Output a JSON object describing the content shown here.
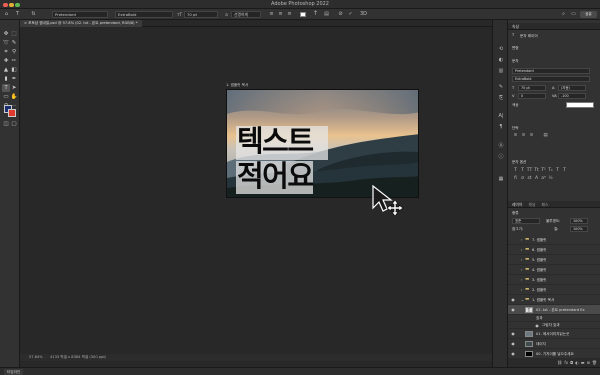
{
  "app": {
    "title": "Adobe Photoshop 2022"
  },
  "options_bar": {
    "font_family": "Pretendard",
    "font_style": "ExtraBold",
    "font_size": "70 pt",
    "antialias": "선명하게",
    "share_label": "공유",
    "tools": [
      "move-icon",
      "text-orient-icon",
      "align-left-icon",
      "align-center-icon",
      "align-right-icon",
      "color-swatch",
      "warp-text-icon",
      "character-panel-icon",
      "cancel-icon",
      "commit-icon",
      "3d-icon"
    ]
  },
  "document": {
    "tab_title": "포토샵 썸네일.psd @ 57.8% (02. txt - 폰트 pretendard, RGB/8) *",
    "artboard_label": "1. 썸플릿 목서",
    "text_line1": "텍스트",
    "text_line2": "적어요",
    "zoom": "57.84%",
    "dimensions": "4133 픽셀 x 8384 픽셀 (300 ppi)",
    "bottom_tab": "타임라인"
  },
  "properties": {
    "header": "속성",
    "type_layer": "문자 레이어",
    "transform_label": "변형",
    "char_label": "문자",
    "font_family": "Pretendard",
    "font_style": "ExtraBold",
    "size": "70 pt",
    "leading": "(자동)",
    "kerning": "0",
    "tracking": "-100",
    "color_label": "색상",
    "paragraph_label": "단락",
    "options_label": "문자 옵션",
    "text_color": "#ffffff"
  },
  "layers_panel": {
    "tabs": [
      "레이어",
      "채널",
      "패스"
    ],
    "filter": "종류",
    "blend": "표준",
    "opacity_label": "불투명도:",
    "opacity": "100%",
    "lock_label": "잠그기:",
    "fill_label": "칠:",
    "fill": "100%",
    "layers": [
      {
        "name": "7. 썸플릿",
        "kind": "group"
      },
      {
        "name": "6. 썸플릿",
        "kind": "group"
      },
      {
        "name": "5. 썸플릿",
        "kind": "group"
      },
      {
        "name": "4. 썸플릿",
        "kind": "group"
      },
      {
        "name": "3. 썸플릿",
        "kind": "group"
      },
      {
        "name": "2. 썸플릿",
        "kind": "group"
      },
      {
        "name": "1. 썸플릿 목서",
        "kind": "group-open"
      },
      {
        "name": "02. txt - 폰트 pretendard Ex",
        "kind": "text-selected"
      },
      {
        "name": "효과",
        "kind": "fx"
      },
      {
        "name": "그림자 효과",
        "kind": "fx-item"
      },
      {
        "name": "01. 에서이미지읽는곳",
        "kind": "image"
      },
      {
        "name": "데이지",
        "kind": "image"
      },
      {
        "name": "00. 기지이를 넣으주세요",
        "kind": "image-black"
      }
    ]
  },
  "colors": {
    "foreground": "#1b2f6e",
    "background": "#e03a2f",
    "accent": "#2f6fd6"
  }
}
